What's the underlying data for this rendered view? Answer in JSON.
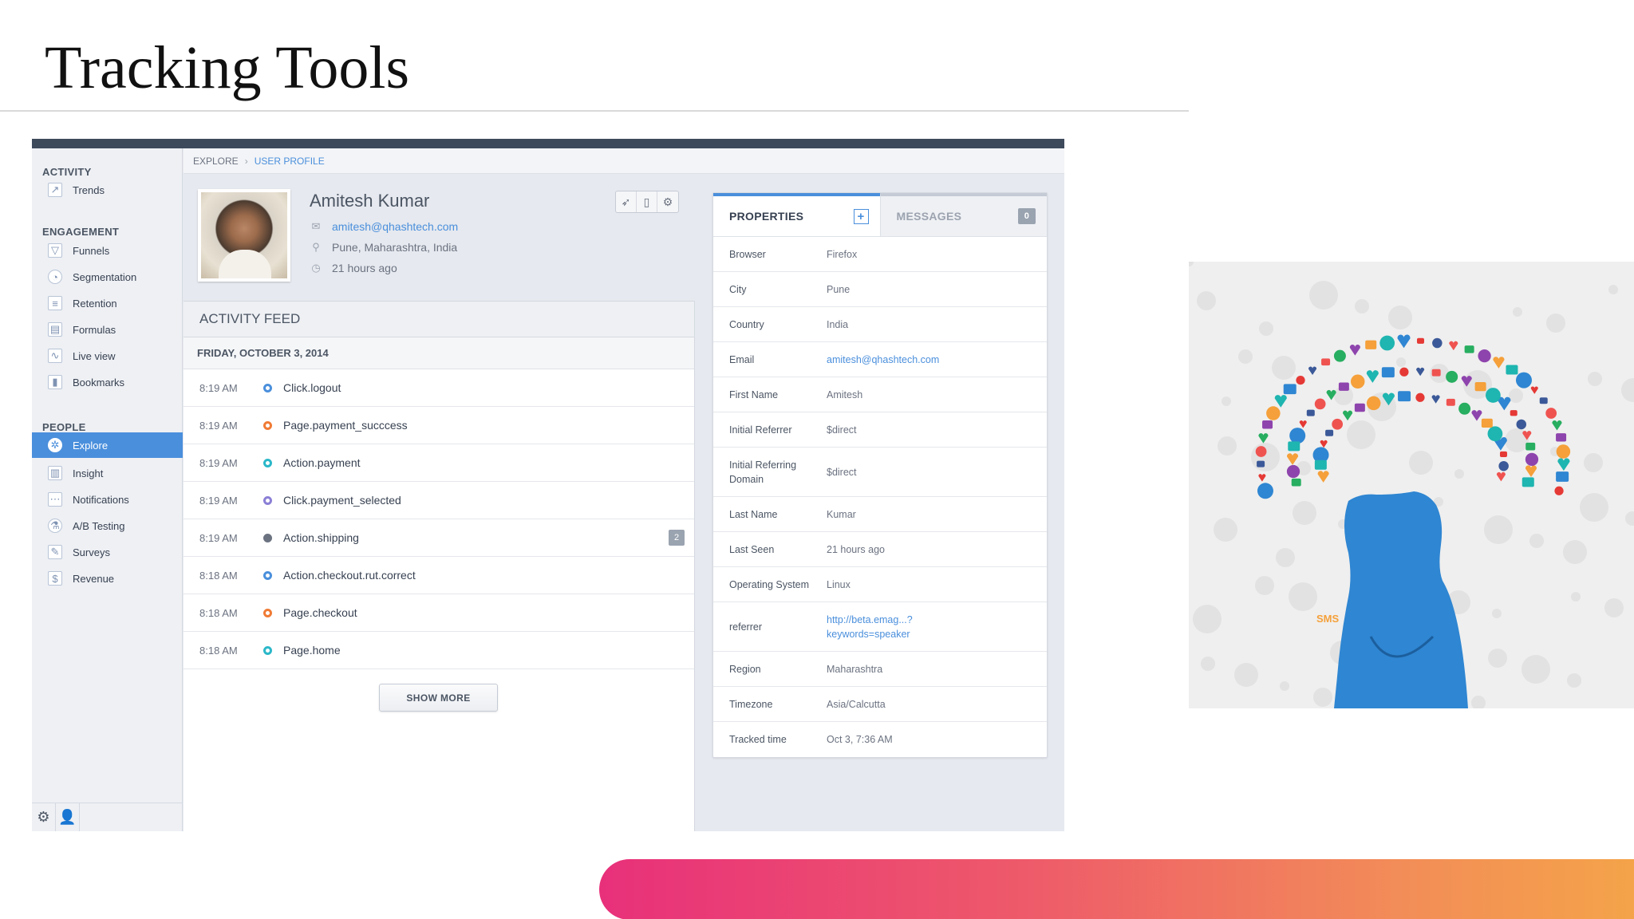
{
  "slide": {
    "title": "Tracking Tools"
  },
  "sidebar": {
    "sections": [
      {
        "label": "ACTIVITY",
        "items": [
          {
            "label": "Trends",
            "icon": "trends-icon"
          }
        ]
      },
      {
        "label": "ENGAGEMENT",
        "items": [
          {
            "label": "Funnels",
            "icon": "funnel-icon"
          },
          {
            "label": "Segmentation",
            "icon": "pie-icon"
          },
          {
            "label": "Retention",
            "icon": "retention-icon"
          },
          {
            "label": "Formulas",
            "icon": "formula-icon"
          },
          {
            "label": "Live view",
            "icon": "live-icon"
          },
          {
            "label": "Bookmarks",
            "icon": "bookmark-icon"
          }
        ]
      },
      {
        "label": "PEOPLE",
        "items": [
          {
            "label": "Explore",
            "icon": "explore-icon",
            "active": true
          },
          {
            "label": "Insight",
            "icon": "insight-icon"
          },
          {
            "label": "Notifications",
            "icon": "notification-icon"
          },
          {
            "label": "A/B Testing",
            "icon": "ab-test-icon"
          },
          {
            "label": "Surveys",
            "icon": "survey-icon"
          },
          {
            "label": "Revenue",
            "icon": "revenue-icon"
          }
        ]
      }
    ],
    "bottom_icons": [
      "gear-icon",
      "add-user-icon"
    ]
  },
  "breadcrumb": {
    "root": "EXPLORE",
    "sep": "›",
    "current": "USER PROFILE"
  },
  "profile": {
    "name": "Amitesh Kumar",
    "email": "amitesh@qhashtech.com",
    "location": "Pune, Maharashtra, India",
    "last_seen": "21 hours ago"
  },
  "feed": {
    "title": "ACTIVITY FEED",
    "date": "FRIDAY, OCTOBER 3, 2014",
    "rows": [
      {
        "time": "8:19 AM",
        "event": "Click.logout",
        "color": "#4a8fdc"
      },
      {
        "time": "8:19 AM",
        "event": "Page.payment_succcess",
        "color": "#f07b35"
      },
      {
        "time": "8:19 AM",
        "event": "Action.payment",
        "color": "#2bb8c9"
      },
      {
        "time": "8:19 AM",
        "event": "Click.payment_selected",
        "color": "#8a7fd6"
      },
      {
        "time": "8:19 AM",
        "event": "Action.shipping",
        "color": "#6b7280",
        "count": "2"
      },
      {
        "time": "8:18 AM",
        "event": "Action.checkout.rut.correct",
        "color": "#4a8fdc"
      },
      {
        "time": "8:18 AM",
        "event": "Page.checkout",
        "color": "#f07b35"
      },
      {
        "time": "8:18 AM",
        "event": "Page.home",
        "color": "#2bb8c9"
      }
    ],
    "show_more": "SHOW MORE"
  },
  "properties": {
    "tab_properties": "PROPERTIES",
    "tab_add": "+",
    "tab_messages": "MESSAGES",
    "messages_count": "0",
    "rows": [
      {
        "key": "Browser",
        "value": "Firefox"
      },
      {
        "key": "City",
        "value": "Pune"
      },
      {
        "key": "Country",
        "value": "India"
      },
      {
        "key": "Email",
        "value": "amitesh@qhashtech.com",
        "link": true
      },
      {
        "key": "First Name",
        "value": "Amitesh"
      },
      {
        "key": "Initial Referrer",
        "value": "$direct"
      },
      {
        "key": "Initial Referring Domain",
        "value": "$direct"
      },
      {
        "key": "Last Name",
        "value": "Kumar"
      },
      {
        "key": "Last Seen",
        "value": "21 hours ago"
      },
      {
        "key": "Operating System",
        "value": "Linux"
      },
      {
        "key": "referrer",
        "value": "http://beta.emag...?\nkeywords=speaker",
        "link": true
      },
      {
        "key": "Region",
        "value": "Maharashtra"
      },
      {
        "key": "Timezone",
        "value": "Asia/Calcutta"
      },
      {
        "key": "Tracked time",
        "value": "Oct 3, 7:36 AM"
      }
    ]
  },
  "illustration": {
    "badge_text": "SMS"
  }
}
